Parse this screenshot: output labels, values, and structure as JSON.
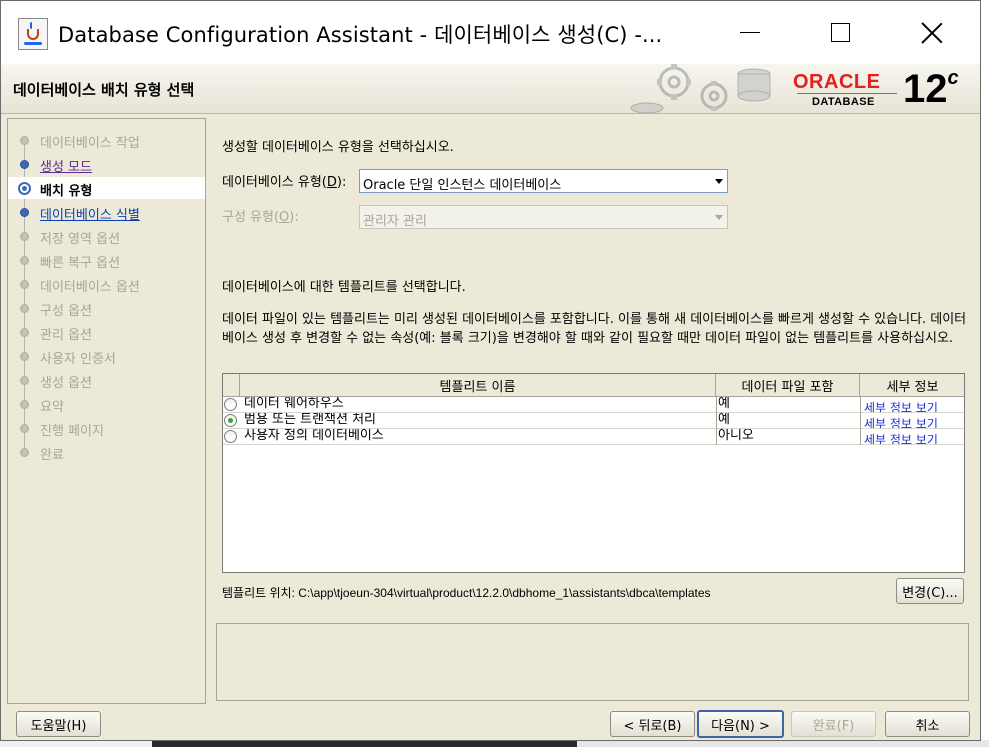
{
  "window": {
    "title": "Database Configuration Assistant - 데이터베이스 생성(C) -..."
  },
  "header": {
    "step_title": "데이터베이스 배치 유형 선택",
    "brand_word": "ORACLE",
    "brand_sub": "DATABASE",
    "version_main": "12",
    "version_sup": "c"
  },
  "nav": {
    "items": [
      {
        "label": "데이터베이스 작업",
        "state": "disabled"
      },
      {
        "label": "생성 모드",
        "state": "visited"
      },
      {
        "label": "배치 유형",
        "state": "current"
      },
      {
        "label": "데이터베이스 식별",
        "state": "link"
      },
      {
        "label": "저장 영역 옵션",
        "state": "disabled"
      },
      {
        "label": "빠른 복구 옵션",
        "state": "disabled"
      },
      {
        "label": "데이터베이스 옵션",
        "state": "disabled"
      },
      {
        "label": "구성 옵션",
        "state": "disabled"
      },
      {
        "label": "관리 옵션",
        "state": "disabled"
      },
      {
        "label": "사용자 인증서",
        "state": "disabled"
      },
      {
        "label": "생성 옵션",
        "state": "disabled"
      },
      {
        "label": "요약",
        "state": "disabled"
      },
      {
        "label": "진행 페이지",
        "state": "disabled"
      },
      {
        "label": "완료",
        "state": "disabled"
      }
    ]
  },
  "main": {
    "intro": "생성할 데이터베이스 유형을 선택하십시오.",
    "db_type_label": "데이터베이스 유형(",
    "db_type_key": "D",
    "db_type_suffix": "):",
    "db_type_value": "Oracle 단일 인스턴스 데이터베이스",
    "config_type_label": "구성 유형(",
    "config_type_key": "O",
    "config_type_suffix": "):",
    "config_type_value": "관리자 관리",
    "template_prompt": "데이터베이스에 대한 템플리트를 선택합니다.",
    "description": "데이터 파일이 있는 템플리트는 미리 생성된 데이터베이스를 포함합니다. 이를 통해 새 데이터베이스를 빠르게 생성할 수 있습니다. 데이터베이스 생성 후 변경할 수 없는 속성(예: 블록 크기)을 변경해야 할 때와 같이 필요할 때만 데이터 파일이 없는 템플리트를 사용하십시오.",
    "table": {
      "headers": [
        "템플리트 이름",
        "데이터 파일 포함",
        "세부 정보"
      ],
      "rows": [
        {
          "name": "데이터 웨어하우스",
          "datafiles": "예",
          "details": "세부 정보 보기",
          "selected": false
        },
        {
          "name": "범용 또는 트랜잭션 처리",
          "datafiles": "예",
          "details": "세부 정보 보기",
          "selected": true
        },
        {
          "name": "사용자 정의 데이터베이스",
          "datafiles": "아니오",
          "details": "세부 정보 보기",
          "selected": false
        }
      ]
    },
    "template_location": "템플리트 위치: C:\\app\\tjoeun-304\\virtual\\product\\12.2.0\\dbhome_1\\assistants\\dbca\\templates",
    "change_button": "변경(C)..."
  },
  "footer": {
    "help": "도움말(H)",
    "back": "< 뒤로(B)",
    "next": "다음(N) >",
    "finish": "완료(F)",
    "cancel": "취소"
  }
}
